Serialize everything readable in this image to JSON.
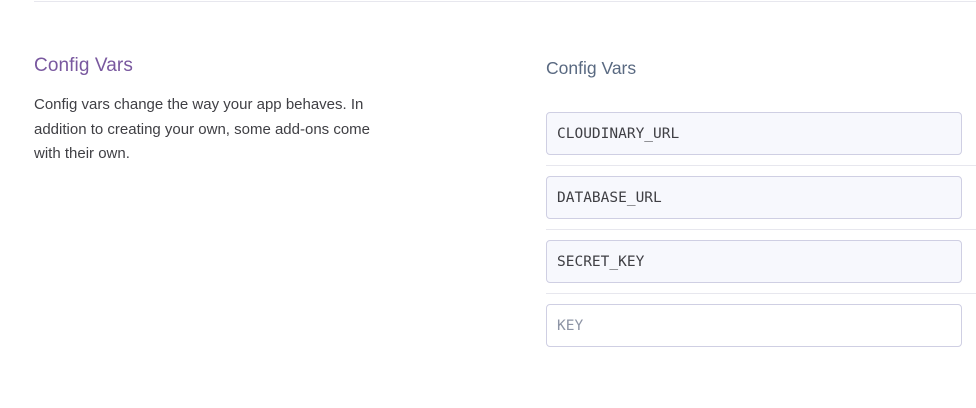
{
  "config_vars_section": {
    "title": "Config Vars",
    "description": "Config vars change the way your app behaves. In addition to creating your own, some add-ons come with their own."
  },
  "vars_panel": {
    "heading": "Config Vars",
    "items": [
      {
        "key": "CLOUDINARY_URL"
      },
      {
        "key": "DATABASE_URL"
      },
      {
        "key": "SECRET_KEY"
      }
    ],
    "new_key_placeholder": "KEY"
  }
}
